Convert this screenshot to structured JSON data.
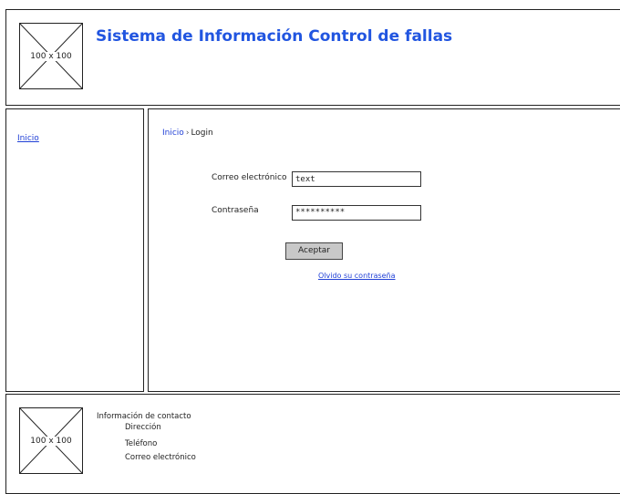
{
  "header": {
    "logo_placeholder": "100 x 100",
    "title": "Sistema de Información Control de fallas"
  },
  "sidebar": {
    "items": [
      {
        "label": "Inicio"
      }
    ]
  },
  "main": {
    "breadcrumb": {
      "home": "Inicio",
      "separator": "›",
      "current": "Login"
    },
    "form": {
      "email_label": "Correo electrónico",
      "email_value": "text",
      "password_label": "Contraseña",
      "password_value": "**********",
      "submit_label": "Aceptar",
      "forgot_link": "Olvido su contraseña"
    }
  },
  "footer": {
    "logo_placeholder": "100 x 100",
    "contact_heading": "Información de contacto",
    "address": "Dirección",
    "phone": "Teléfono",
    "email": "Correo electrónico"
  },
  "colors": {
    "title": "#2155e0",
    "link": "#1f3fd6",
    "button": "#c8c8c8"
  }
}
